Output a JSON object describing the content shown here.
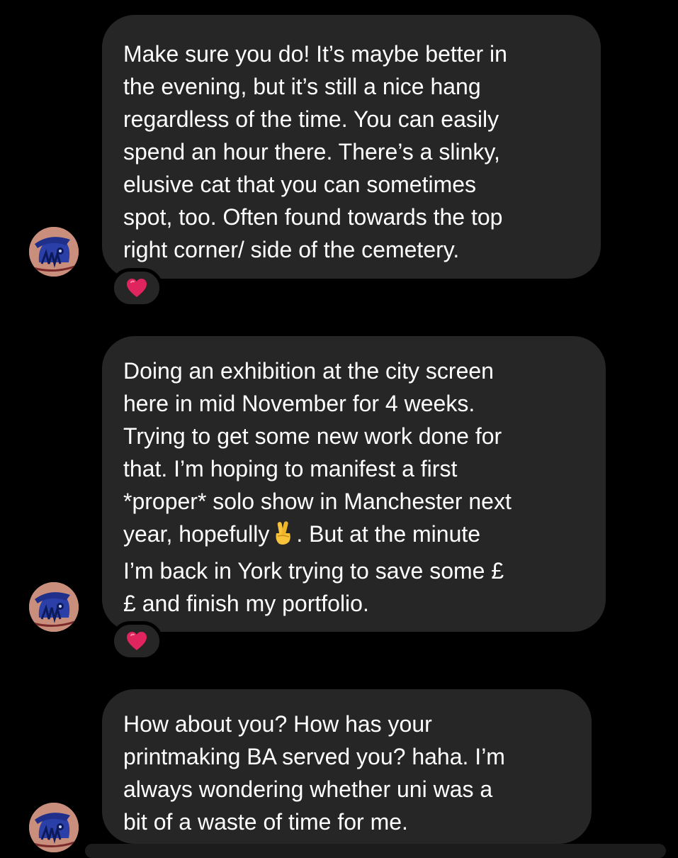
{
  "messages": [
    {
      "lines": [
        "Make sure you do! It’s maybe better in",
        "the evening, but it’s still a nice hang",
        "regardless of the time. You can easily",
        "spend an hour there. There’s a slinky,",
        "elusive cat that you can sometimes",
        "spot, too. Often found towards the top",
        "right corner/ side of the cemetery."
      ],
      "reaction": "heart-emoji"
    },
    {
      "lines": [
        "Doing an exhibition at the city screen",
        "here in mid November for 4 weeks.",
        "Trying to get some new work done for",
        "that. I’m hoping to manifest a first",
        "*proper* solo show in Manchester next"
      ],
      "line6_before": "year, hopefully",
      "line6_emoji": "crossed-fingers-emoji",
      "line6_after": ". But at the minute",
      "lines_end": [
        "I’m back in York trying to save some £",
        "£ and finish my portfolio."
      ],
      "reaction": "heart-emoji"
    },
    {
      "lines": [
        "How about you? How has your",
        "printmaking BA served you? haha. I’m",
        "always wondering whether uni was a",
        "bit of a waste of time for me."
      ]
    }
  ],
  "colors": {
    "background": "#000000",
    "bubble": "#262626",
    "text": "#ffffff",
    "heart": "#e0245e"
  }
}
